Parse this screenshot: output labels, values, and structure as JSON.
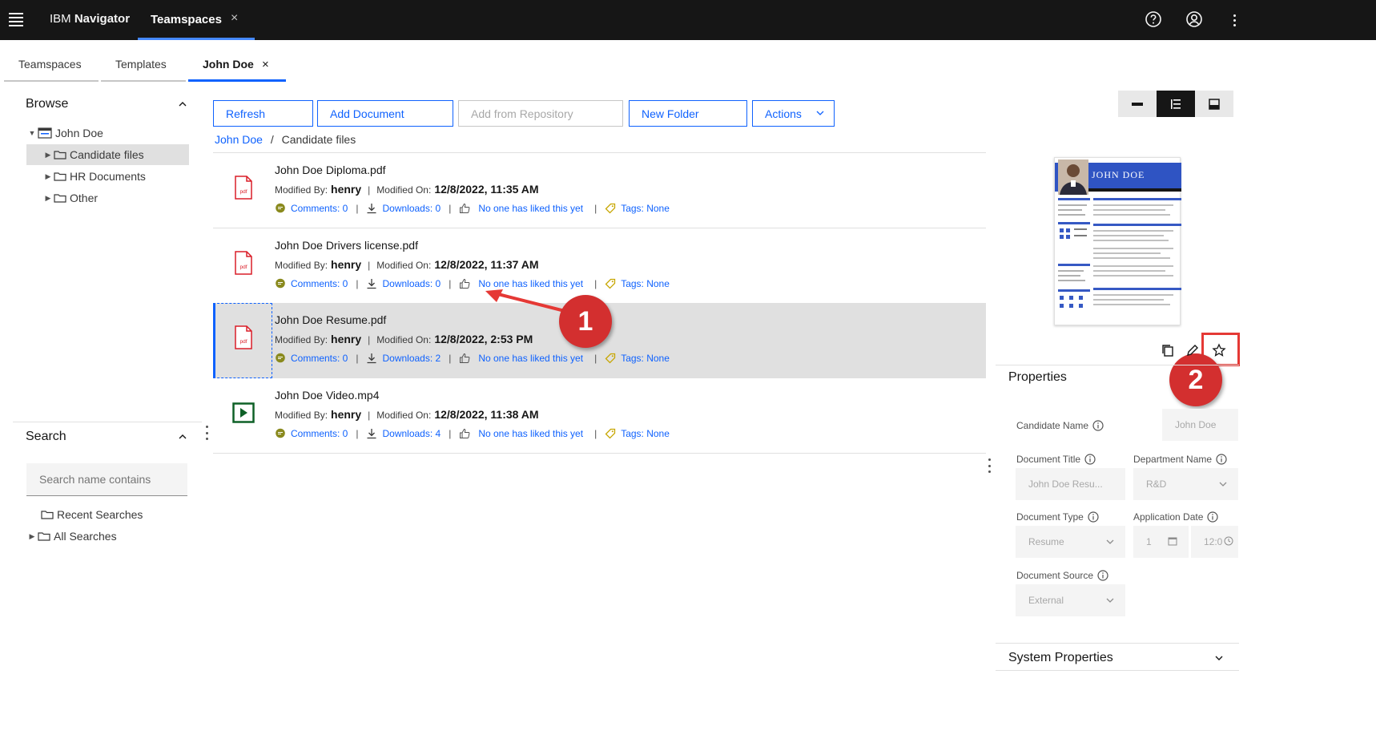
{
  "app": {
    "brand_prefix": "IBM",
    "brand_name": "Navigator"
  },
  "topbar": {
    "active_tab": "Teamspaces",
    "close": "×"
  },
  "subtabs": [
    {
      "label": "Teamspaces"
    },
    {
      "label": "Templates"
    },
    {
      "label": "John Doe",
      "close": "×"
    }
  ],
  "browse": {
    "title": "Browse",
    "root": "John Doe",
    "folders": [
      "Candidate files",
      "HR Documents",
      "Other"
    ]
  },
  "search": {
    "title": "Search",
    "placeholder": "Search name contains",
    "items": [
      "Recent Searches",
      "All Searches"
    ]
  },
  "toolbar": {
    "refresh": "Refresh",
    "add_document": "Add Document",
    "add_from_repository": "Add from Repository",
    "new_folder": "New Folder",
    "actions": "Actions"
  },
  "breadcrumb": {
    "root": "John Doe",
    "sep": "/",
    "current": "Candidate files"
  },
  "labels": {
    "modified_by": "Modified By:",
    "modified_on": "Modified On:",
    "pipe": "|",
    "likes": "No one has liked this yet",
    "tags": "Tags: None"
  },
  "documents": [
    {
      "name": "John Doe Diploma.pdf",
      "type": "pdf",
      "modified_by": "henry",
      "modified_on": "12/8/2022, 11:35 AM",
      "comments": "Comments: 0",
      "downloads": "Downloads: 0"
    },
    {
      "name": "John Doe Drivers license.pdf",
      "type": "pdf",
      "modified_by": "henry",
      "modified_on": "12/8/2022, 11:37 AM",
      "comments": "Comments: 0",
      "downloads": "Downloads: 0"
    },
    {
      "name": "John Doe Resume.pdf",
      "type": "pdf",
      "modified_by": "henry",
      "modified_on": "12/8/2022, 2:53 PM",
      "comments": "Comments: 0",
      "downloads": "Downloads: 2"
    },
    {
      "name": "John Doe Video.mp4",
      "type": "video",
      "modified_by": "henry",
      "modified_on": "12/8/2022, 11:38 AM",
      "comments": "Comments: 0",
      "downloads": "Downloads: 4"
    }
  ],
  "annotations": [
    "1",
    "2"
  ],
  "thumbnail": {
    "name": "JOHN DOE"
  },
  "properties": {
    "title": "Properties",
    "candidate_name": {
      "label": "Candidate Name",
      "value": "John Doe"
    },
    "document_title": {
      "label": "Document Title",
      "value": "John Doe Resu..."
    },
    "department_name": {
      "label": "Department Name",
      "value": "R&D"
    },
    "document_type": {
      "label": "Document Type",
      "value": "Resume"
    },
    "application_date": {
      "label": "Application Date",
      "date": "1",
      "time": "12:0"
    },
    "document_source": {
      "label": "Document Source",
      "value": "External"
    }
  },
  "system_properties": {
    "title": "System Properties"
  },
  "colors": {
    "accent": "#0f62fe",
    "topbar": "#161616",
    "annotation": "#d32f2f",
    "pdf": "#da1e28",
    "video": "#0e6027"
  }
}
